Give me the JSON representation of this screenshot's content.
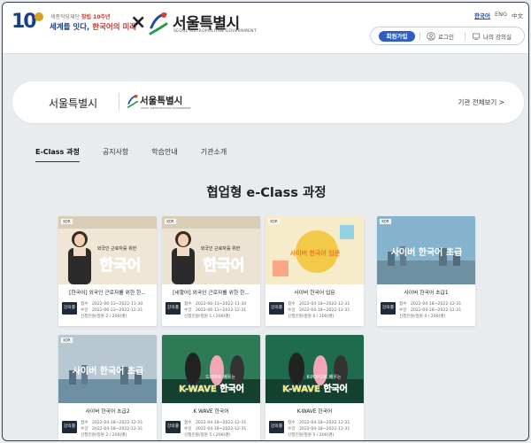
{
  "header": {
    "anniversary_number": "10",
    "slogan_prefix": "세종학당재단 ",
    "slogan_highlight": "창립 10주년",
    "slogan_main_1": "세계를 잇다, ",
    "slogan_main_2": "한국어의 미래",
    "cross": "×",
    "partner_name": "서울특별시",
    "partner_sub": "SEOUL METROPOLITAN GOVERNMENT",
    "languages": [
      "한국어",
      "ENG",
      "中文"
    ],
    "active_language": "한국어",
    "join_label": "회원가입",
    "login_label": "로그인",
    "my_lecture_label": "나의 강의실"
  },
  "institution": {
    "title": "서울특별시",
    "logo_name": "서울특별시",
    "logo_sub": "SEOUL METROPOLITAN GOVERNMENT",
    "view_all_label": "기관 전체보기 >"
  },
  "tabs": [
    {
      "label": "E-Class 과정",
      "active": true
    },
    {
      "label": "공지사항",
      "active": false
    },
    {
      "label": "학습안내",
      "active": false
    },
    {
      "label": "기관소개",
      "active": false
    }
  ],
  "page_title": "협업형 e-Class 과정",
  "labels": {
    "study_key": "접수",
    "learn_key": "수강",
    "apply_key": "신청인원/정원",
    "badge": "강의중"
  },
  "courses": [
    {
      "title": "[한국어] 외국인 근로자를 위한 한...",
      "apply": "2022-06-13~2022-11-30",
      "learn": "2022-06-13~2022-12-31",
      "count": "2 / 200(명)",
      "thumb_text": "한국어",
      "thumb_sub": "외국인 근로자를 위한",
      "thumb_tag": "KOR",
      "bg": "#efe6d6",
      "accent": "#c0392b"
    },
    {
      "title": "[네팔어] 외국인 근로자를 위한 한...",
      "apply": "2022-06-13~2022-11-30",
      "learn": "2022-06-13~2022-12-31",
      "count": "1 / 200(명)",
      "thumb_text": "한국어",
      "thumb_sub": "외국인 근로자를 위한",
      "thumb_tag": "KOR",
      "bg": "#ece3d2",
      "accent": "#c0392b"
    },
    {
      "title": "사이버 한국어 입문",
      "apply": "2022-04-18~2022-12-31",
      "learn": "2022-04-18~2022-12-31",
      "count": "6 / 200(명)",
      "thumb_text": "사이버 한국어 입문",
      "thumb_sub": "",
      "thumb_tag": "KOR",
      "bg": "#f6ecc9",
      "accent": "#e67e22"
    },
    {
      "title": "사이버 한국어 초급1",
      "apply": "2022-04-18~2022-12-31",
      "learn": "2022-04-18~2022-12-31",
      "count": "4 / 200(명)",
      "thumb_text": "사이버 한국어 초급",
      "thumb_sub": "",
      "thumb_tag": "KOR",
      "bg": "#86b4cf",
      "accent": "#ffffff"
    },
    {
      "title": "사이버 한국어 초급2",
      "apply": "2022-04-18~2022-12-31",
      "learn": "2022-04-18~2022-12-31",
      "count": "2 / 200(명)",
      "thumb_text": "사이버 한국어 초급",
      "thumb_sub": "",
      "thumb_tag": "KOR",
      "bg": "#b8c8d2",
      "accent": "#ffffff"
    },
    {
      "title": "K WAVE 한국어",
      "apply": "2022-04-18~2022-12-31",
      "learn": "2022-04-18~2022-12-31",
      "count": "5 / 200(명)",
      "thumb_text": "K-WAVE 한국어",
      "thumb_sub": "드라마로 배우는",
      "thumb_tag": "",
      "bg": "#2e7a57",
      "accent": "#f1e04a"
    },
    {
      "title": "K-WAVE 한국어",
      "apply": "2022-04-18~2022-12-31",
      "learn": "2022-04-18~2022-12-31",
      "count": "5 / 200(명)",
      "thumb_text": "K-WAVE 한국어",
      "thumb_sub": "K-POP으로 배우는",
      "thumb_tag": "",
      "bg": "#1f6b4d",
      "accent": "#f1e04a"
    }
  ]
}
